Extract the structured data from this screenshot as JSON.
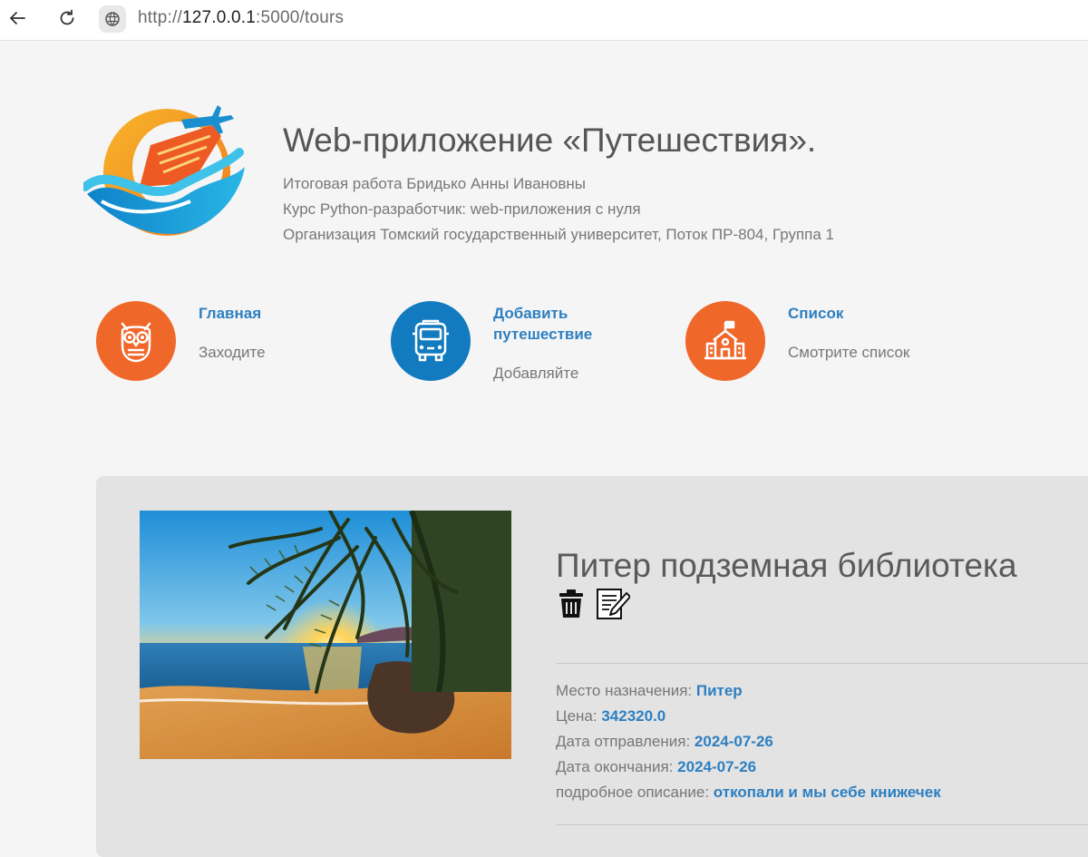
{
  "browser": {
    "url_prefix": "http://",
    "url_host": "127.0.0.1",
    "url_rest": ":5000/tours"
  },
  "header": {
    "title": "Web-приложение «Путешествия».",
    "line1": "Итоговая работа Бридько Анны Ивановны",
    "line2": "Курс Python-разработчик: web-приложения с нуля",
    "line3": "Организация Томский государственный университет, Поток ПР-804, Группа 1"
  },
  "nav": [
    {
      "title": "Главная",
      "desc": "Заходите",
      "icon": "owl-icon",
      "color": "#f0672a"
    },
    {
      "title_line1": "Добавить",
      "title_line2": "путешествие",
      "desc": "Добавляйте",
      "icon": "bus-icon",
      "color": "#127bbf"
    },
    {
      "title": "Список",
      "desc": "Смотрите список",
      "icon": "school-icon",
      "color": "#f0672a"
    }
  ],
  "tour": {
    "title": "Питер подземная библиотека",
    "destination_label": "Место назначения:",
    "destination": "Питер",
    "price_label": "Цена:",
    "price": "342320.0",
    "start_label": "Дата отправления:",
    "start": "2024-07-26",
    "end_label": "Дата окончания:",
    "end": "2024-07-26",
    "desc_label": "подробное описание:",
    "desc": "откопали и мы себе книжечек"
  }
}
